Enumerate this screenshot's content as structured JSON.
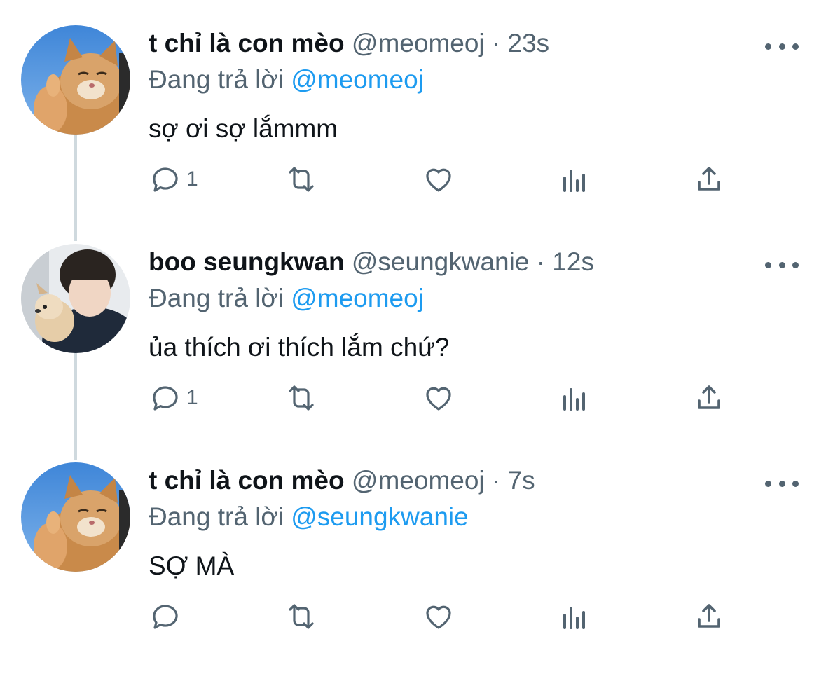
{
  "tweets": [
    {
      "name": "t chỉ là con mèo",
      "handle": "@meomeoj",
      "dot": "·",
      "time": "23s",
      "replying_prefix": "Đang trả lời",
      "replying_to": "@meomeoj",
      "text": "sợ ơi sợ lắmmm",
      "reply_count": "1",
      "avatar": "cat-avatar"
    },
    {
      "name": "boo seungkwan",
      "handle": "@seungkwanie",
      "dot": "·",
      "time": "12s",
      "replying_prefix": "Đang trả lời",
      "replying_to": "@meomeoj",
      "text": "ủa thích ơi thích lắm chứ?",
      "reply_count": "1",
      "avatar": "person-with-dog-avatar"
    },
    {
      "name": "t chỉ là con mèo",
      "handle": "@meomeoj",
      "dot": "·",
      "time": "7s",
      "replying_prefix": "Đang trả lời",
      "replying_to": "@seungkwanie",
      "text": "SỢ MÀ",
      "reply_count": "",
      "avatar": "cat-avatar"
    }
  ],
  "icons": [
    "reply-icon",
    "retweet-icon",
    "like-icon",
    "analytics-icon",
    "share-icon",
    "more-icon"
  ],
  "colors": {
    "text": "#0f1419",
    "secondary": "#536471",
    "link": "#1d9bf0",
    "thread_line": "#cfd9de"
  }
}
